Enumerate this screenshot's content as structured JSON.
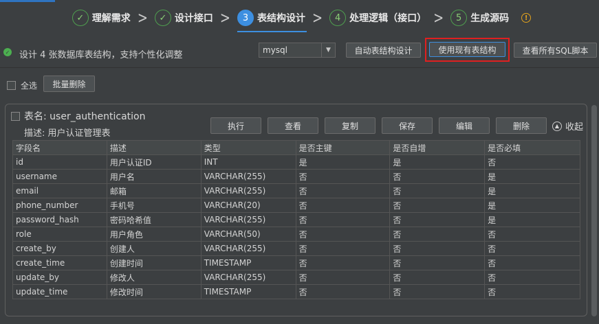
{
  "steps": [
    {
      "num": "✓",
      "label": "理解需求",
      "state": "done"
    },
    {
      "num": "✓",
      "label": "设计接口",
      "state": "done"
    },
    {
      "num": "3",
      "label": "表结构设计",
      "state": "active"
    },
    {
      "num": "4",
      "label": "处理逻辑（接口）",
      "state": "todo"
    },
    {
      "num": "5",
      "label": "生成源码",
      "state": "todo"
    }
  ],
  "info_icon": "!",
  "status": {
    "icon": "check-circle-icon",
    "text": "设计 4 张数据库表结构，支持个性化调整"
  },
  "db_select": {
    "value": "mysql"
  },
  "toolbar": {
    "auto_design": "自动表结构设计",
    "use_existing": "使用现有表结构",
    "view_sql": "查看所有SQL脚本"
  },
  "select_all": {
    "label": "全选",
    "batch_delete": "批量删除"
  },
  "card": {
    "name_label": "表名: user_authentication",
    "desc_label": "描述: 用户认证管理表",
    "actions": [
      "执行",
      "查看",
      "复制",
      "保存",
      "编辑",
      "删除"
    ],
    "collapse": "收起",
    "columns": [
      "字段名",
      "描述",
      "类型",
      "是否主键",
      "是否自增",
      "是否必填"
    ],
    "rows": [
      [
        "id",
        "用户认证ID",
        "INT",
        "是",
        "是",
        "否"
      ],
      [
        "username",
        "用户名",
        "VARCHAR(255)",
        "否",
        "否",
        "是"
      ],
      [
        "email",
        "邮箱",
        "VARCHAR(255)",
        "否",
        "否",
        "是"
      ],
      [
        "phone_number",
        "手机号",
        "VARCHAR(20)",
        "否",
        "否",
        "是"
      ],
      [
        "password_hash",
        "密码哈希值",
        "VARCHAR(255)",
        "否",
        "否",
        "是"
      ],
      [
        "role",
        "用户角色",
        "VARCHAR(50)",
        "否",
        "否",
        "否"
      ],
      [
        "create_by",
        "创建人",
        "VARCHAR(255)",
        "否",
        "否",
        "否"
      ],
      [
        "create_time",
        "创建时间",
        "TIMESTAMP",
        "否",
        "否",
        "否"
      ],
      [
        "update_by",
        "修改人",
        "VARCHAR(255)",
        "否",
        "否",
        "否"
      ],
      [
        "update_time",
        "修改时间",
        "TIMESTAMP",
        "否",
        "否",
        "否"
      ]
    ]
  },
  "colors": {
    "accent": "#3d8fe0",
    "success": "#4caf50",
    "highlight": "#e02020",
    "warning": "#e1a21d"
  }
}
